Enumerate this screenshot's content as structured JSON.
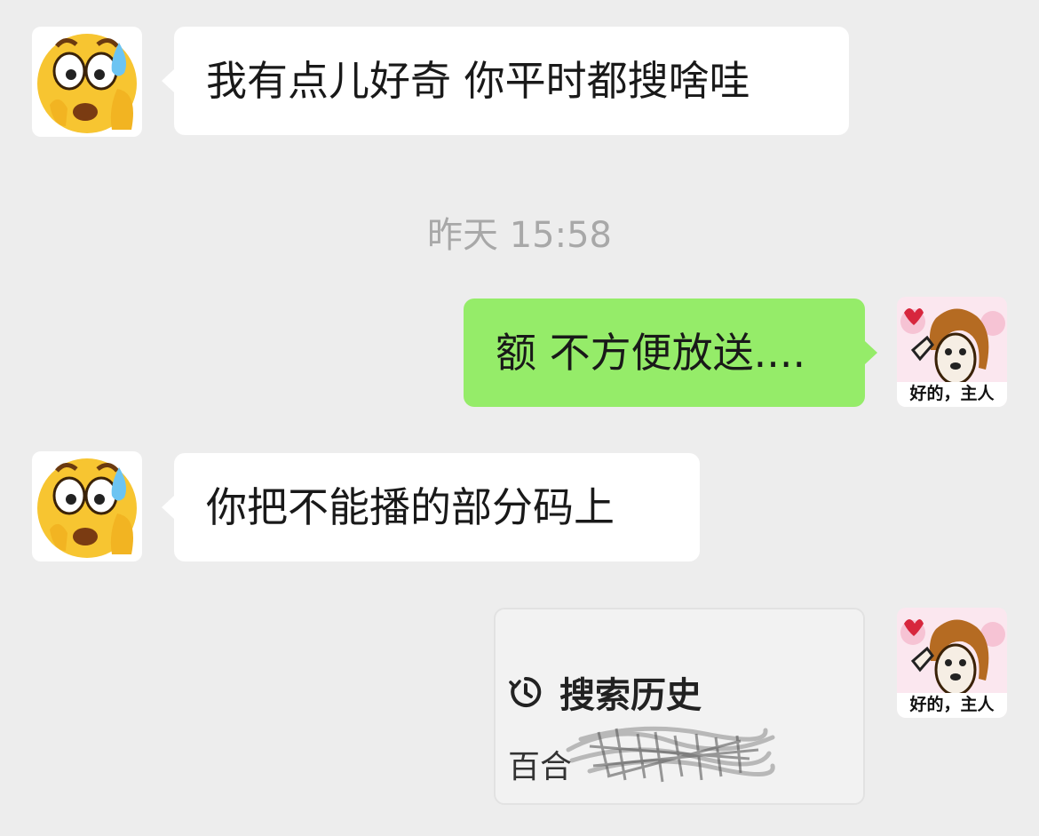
{
  "messages": [
    {
      "direction": "incoming",
      "text": "我有点儿好奇 你平时都搜啥哇"
    },
    {
      "direction": "outgoing",
      "text": "额 不方便放送...."
    },
    {
      "direction": "incoming",
      "text": "你把不能播的部分码上"
    }
  ],
  "timestamp": "昨天 15:58",
  "shared_card": {
    "icon": "history-clock-icon",
    "title": "搜索历史",
    "item": "百合",
    "item_redacted": true
  },
  "avatars": {
    "contact": {
      "icon": "anxious-emoji-icon"
    },
    "me": {
      "icon": "saluting-dog-sticker-icon",
      "caption": "好的，主人"
    }
  },
  "colors": {
    "background": "#ededed",
    "incoming_bubble": "#ffffff",
    "outgoing_bubble": "#95ec69",
    "timestamp_text": "#a8a8a8"
  }
}
